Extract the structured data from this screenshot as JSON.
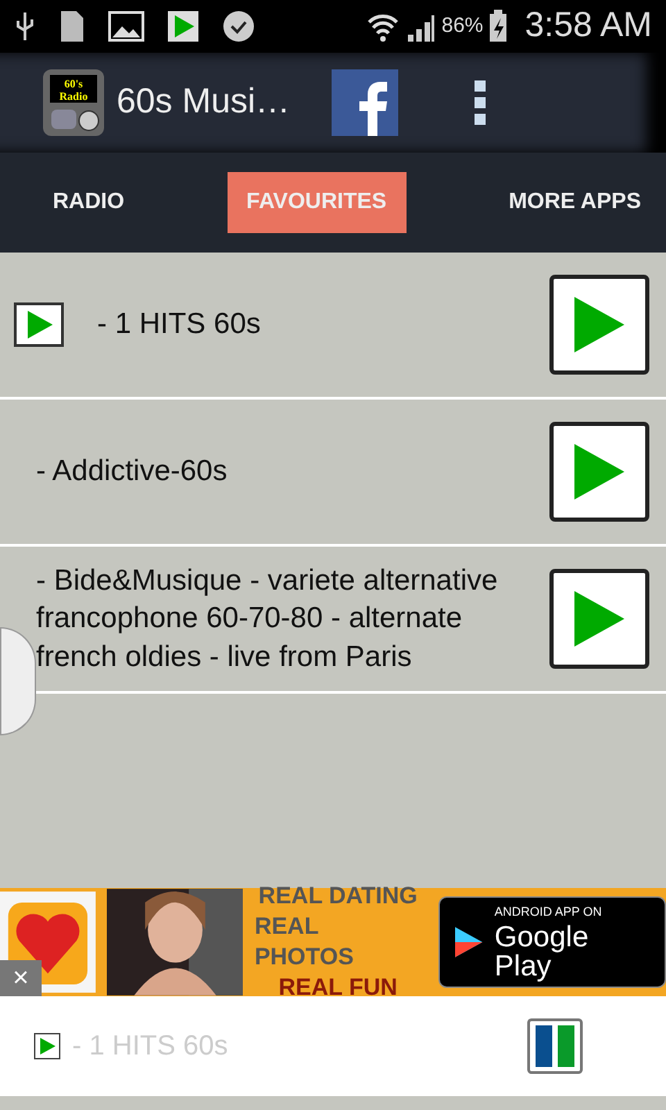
{
  "status_bar": {
    "battery": "86%",
    "time": "3:58 AM"
  },
  "app_bar": {
    "title": "60s Musi…",
    "logo_text": [
      "60's",
      "Radio"
    ]
  },
  "tabs": [
    {
      "label": "RADIO",
      "selected": false
    },
    {
      "label": "FAVOURITES",
      "selected": true
    },
    {
      "label": "MORE APPS",
      "selected": false
    }
  ],
  "stations": [
    {
      "name": "- 1 HITS 60s",
      "playing": true
    },
    {
      "name": "- Addictive-60s",
      "playing": false
    },
    {
      "name": "- Bide&Musique - variete alternative francophone 60-70-80 - alternate french oldies - live from Paris",
      "playing": false
    }
  ],
  "ad": {
    "lines": [
      "REAL DATING",
      "REAL PHOTOS",
      "REAL FUN"
    ],
    "store_small": "ANDROID APP ON",
    "store_big": "Google Play",
    "close": "×"
  },
  "player": {
    "station": "- 1 HITS 60s",
    "paused": false
  }
}
